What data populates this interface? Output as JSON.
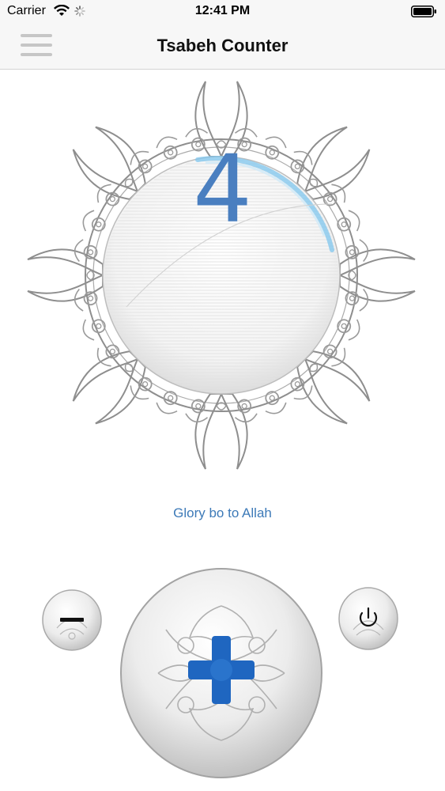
{
  "status_bar": {
    "carrier": "Carrier",
    "time": "12:41 PM"
  },
  "nav": {
    "title": "Tsabeh Counter"
  },
  "counter": {
    "value": "4",
    "phrase": "Glory bo to Allah"
  },
  "colors": {
    "accent": "#4a7fc0",
    "phrase": "#3d7ab8",
    "ornament": "#8e8e8e",
    "plus": "#1f66c0"
  },
  "icons": {
    "menu": "hamburger-icon",
    "minus": "minus-icon",
    "plus": "plus-icon",
    "reset": "power-icon"
  }
}
